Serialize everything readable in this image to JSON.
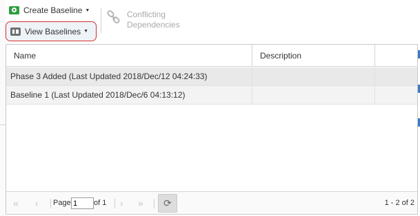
{
  "toolbar": {
    "create_baseline_label": "Create Baseline",
    "view_baselines_label": "View Baselines",
    "conflicting_dependencies_line1": "Conflicting",
    "conflicting_dependencies_line2": "Dependencies",
    "create_icon": "camera-icon",
    "view_icon": "baselines-icon",
    "conflict_icon": "link-icon",
    "highlight_color": "#d32f2f",
    "create_icon_color": "#2e9e3e"
  },
  "grid": {
    "columns": [
      "Name",
      "Description",
      ""
    ],
    "rows": [
      {
        "name": "Phase 3 Added (Last Updated 2018/Dec/12 04:24:33)",
        "description": ""
      },
      {
        "name": "Baseline 1 (Last Updated 2018/Dec/6 04:13:12)",
        "description": ""
      }
    ]
  },
  "pager": {
    "page_label": "Page",
    "page_value": "1",
    "of_label": "of 1",
    "count_label": "1 - 2 of 2",
    "first_icon": "«",
    "prev_icon": "‹",
    "next_icon": "›",
    "last_icon": "»",
    "refresh_icon": "⟳"
  }
}
